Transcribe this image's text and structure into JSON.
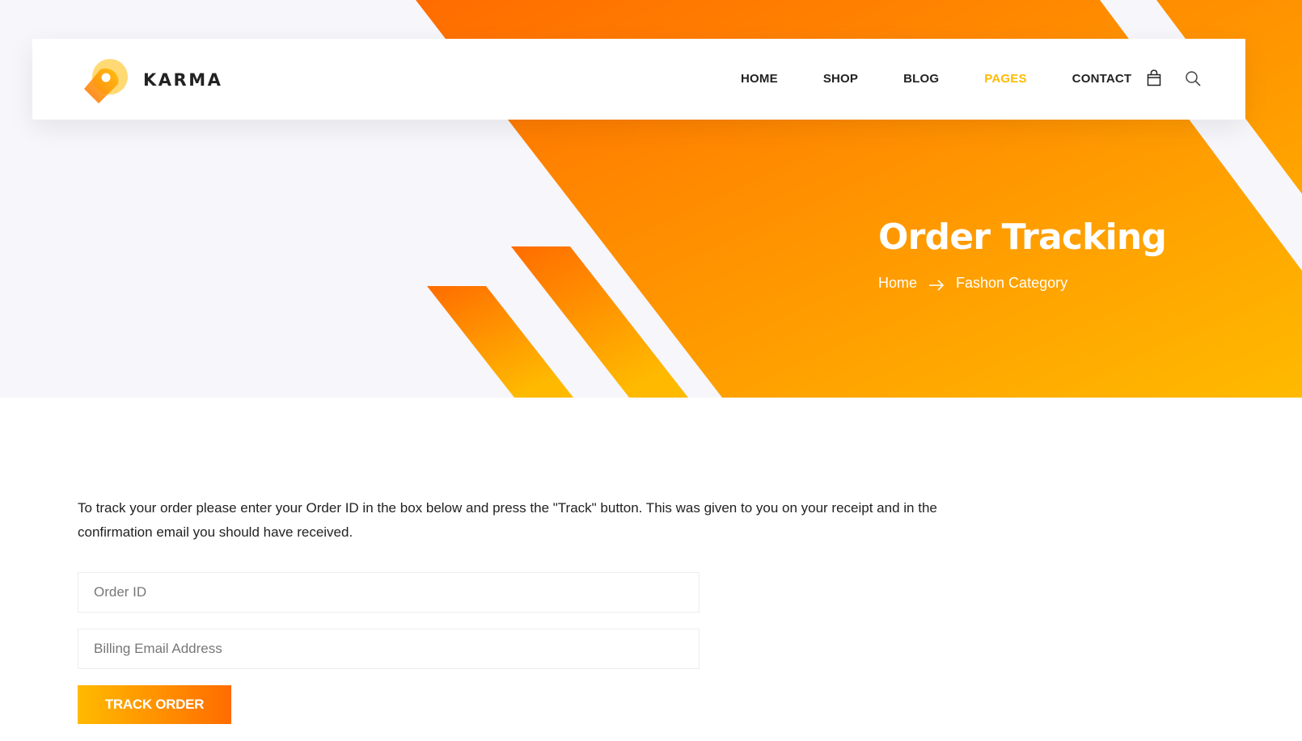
{
  "brand": {
    "name": "KARMA",
    "logo_icon": "map-pin-logo-icon"
  },
  "nav": {
    "items": [
      {
        "label": "HOME",
        "active": false
      },
      {
        "label": "SHOP",
        "active": false
      },
      {
        "label": "BLOG",
        "active": false
      },
      {
        "label": "PAGES",
        "active": true
      },
      {
        "label": "CONTACT",
        "active": false
      }
    ],
    "cart_icon": "shopping-bag-icon",
    "search_icon": "search-icon"
  },
  "hero": {
    "title": "Order Tracking",
    "breadcrumb": {
      "home": "Home",
      "separator_icon": "arrow-right-icon",
      "current": "Fashon Category"
    }
  },
  "content": {
    "intro": "To track your order please enter your Order ID in the box below and press the \"Track\" button. This was given to you on your receipt and in the confirmation email you should have received.",
    "order_id_placeholder": "Order ID",
    "email_placeholder": "Billing Email Address",
    "track_button": "TRACK ORDER"
  },
  "colors": {
    "accent": "#ffba00",
    "accent_dark": "#ff6c00",
    "text": "#222222",
    "hero_background": "#f6f6fb"
  }
}
